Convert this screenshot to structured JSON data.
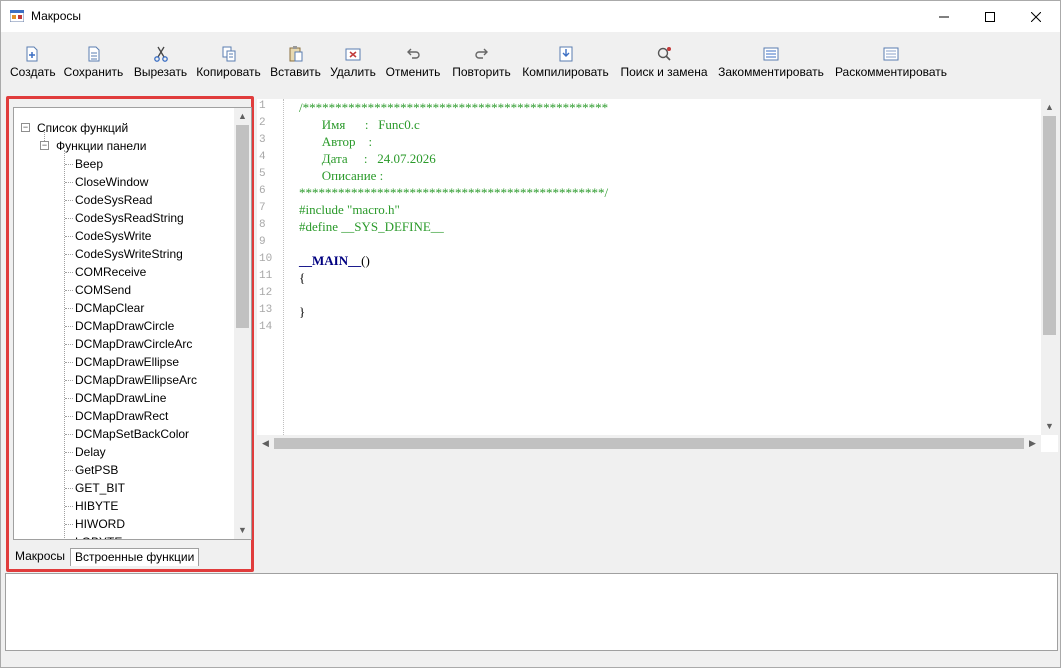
{
  "window": {
    "title": "Макросы",
    "minimize_icon": "minimize-icon",
    "maximize_icon": "maximize-icon",
    "close_icon": "close-icon"
  },
  "toolbar": {
    "create": "Создать",
    "save": "Сохранить",
    "cut": "Вырезать",
    "copy": "Копировать",
    "paste": "Вставить",
    "delete": "Удалить",
    "undo": "Отменить",
    "redo": "Повторить",
    "compile": "Компилировать",
    "find_replace": "Поиск и замена",
    "comment": "Закомментировать",
    "uncomment": "Раскомментировать"
  },
  "tree": {
    "root": "Список функций",
    "group": "Функции панели",
    "items": [
      "Beep",
      "CloseWindow",
      "CodeSysRead",
      "CodeSysReadString",
      "CodeSysWrite",
      "CodeSysWriteString",
      "COMReceive",
      "COMSend",
      "DCMapClear",
      "DCMapDrawCircle",
      "DCMapDrawCircleArc",
      "DCMapDrawEllipse",
      "DCMapDrawEllipseArc",
      "DCMapDrawLine",
      "DCMapDrawRect",
      "DCMapSetBackColor",
      "Delay",
      "GetPSB",
      "GET_BIT",
      "HIBYTE",
      "HIWORD",
      "LOBYTE"
    ]
  },
  "tabs": {
    "macros": "Макросы",
    "builtin": "Встроенные функции"
  },
  "editor": {
    "line_numbers": [
      "1",
      "2",
      "3",
      "4",
      "5",
      "6",
      "7",
      "8",
      "9",
      "10",
      "11",
      "12",
      "13",
      "14"
    ],
    "lines": [
      "/***********************************************",
      "       Имя      :   Func0.c",
      "       Автор    :",
      "       Дата     :   24.07.2026",
      "       Описание :",
      "***********************************************/",
      "#include \"macro.h\"",
      "#define __SYS_DEFINE__",
      "",
      "__MAIN__()",
      "{",
      "",
      "}",
      ""
    ]
  },
  "colors": {
    "comment": "#2a9a2a",
    "keyword": "#000080",
    "panel_border": "#e03c3c"
  }
}
